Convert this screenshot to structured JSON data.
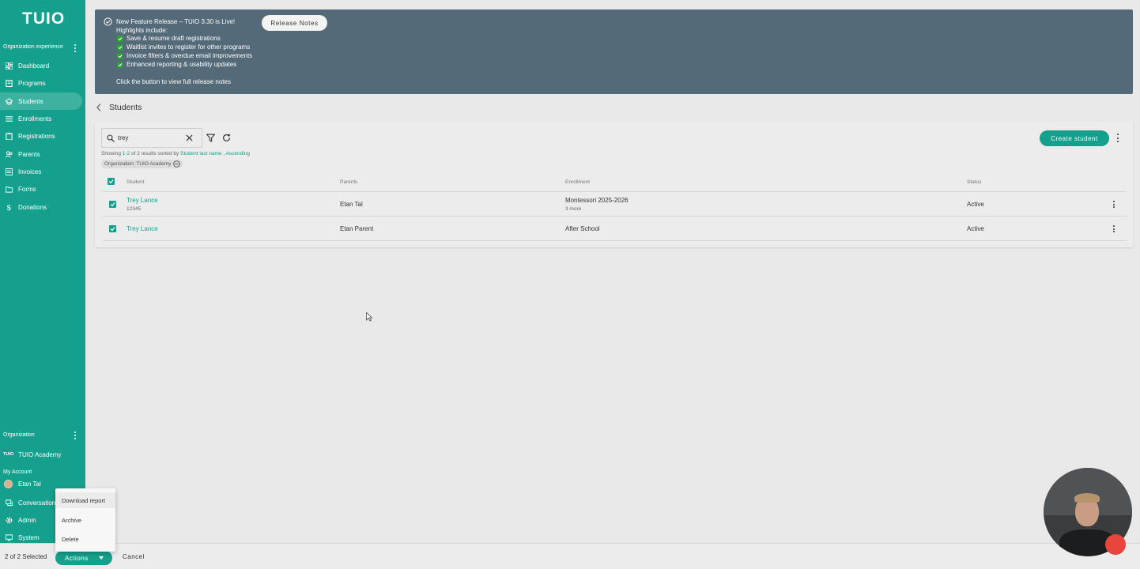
{
  "colors": {
    "brand": "#14a08c",
    "banner": "#546a78",
    "check": "#2f9e3a"
  },
  "sidebar": {
    "logo": "TUIO",
    "section_org_experience": "Organization experience",
    "nav": [
      {
        "label": "Dashboard",
        "icon": "dashboard-icon"
      },
      {
        "label": "Programs",
        "icon": "book-icon"
      },
      {
        "label": "Students",
        "icon": "graduation-cap-icon",
        "active": true
      },
      {
        "label": "Enrollments",
        "icon": "list-icon"
      },
      {
        "label": "Registrations",
        "icon": "clipboard-icon"
      },
      {
        "label": "Parents",
        "icon": "people-icon"
      },
      {
        "label": "Invoices",
        "icon": "receipt-icon"
      },
      {
        "label": "Forms",
        "icon": "folder-icon"
      },
      {
        "label": "Donations",
        "icon": "dollar-icon"
      }
    ],
    "section_organization": "Organization",
    "org_badge": "TUIO",
    "org_name": "TUIO Academy",
    "section_my_account": "My Account",
    "account_name": "Etan Tal",
    "bottom_nav": [
      {
        "label": "Conversations",
        "icon": "chat-icon"
      },
      {
        "label": "Admin",
        "icon": "gear-icon"
      },
      {
        "label": "System",
        "icon": "monitor-icon"
      }
    ]
  },
  "banner": {
    "title": "New Feature Release – TUIO 3.30 is Live!",
    "subtitle": "Highlights include:",
    "highlights": [
      "Save & resume draft registrations",
      "Waitlist invites to register for other programs",
      "Invoice filters & overdue email improvements",
      "Enhanced reporting & usability updates"
    ],
    "footer": "Click the button to view full release notes",
    "button": "Release Notes"
  },
  "page": {
    "title": "Students"
  },
  "toolbar": {
    "search_value": "trey",
    "results_prefix": "Showing ",
    "results_range": "1-2",
    "results_mid": " of 2 results sorted by ",
    "sort_field": "Student last name",
    "sort_sep": " , ",
    "sort_dir": "Ascending",
    "filter_chip": "Organization: TUIO Academy",
    "create_button": "Create student"
  },
  "table": {
    "columns": [
      "Student",
      "Parents",
      "Enrollment",
      "Status"
    ],
    "rows": [
      {
        "student": "Trey Lance",
        "student_id": "12345",
        "parents": "Etan Tal",
        "enrollment": "Montessori 2025-2026",
        "enrollment_more": "3 more",
        "status": "Active",
        "checked": true
      },
      {
        "student": "Trey Lance",
        "student_id": "",
        "parents": "Etan Parent",
        "enrollment": "After School",
        "enrollment_more": "",
        "status": "Active",
        "checked": true
      }
    ]
  },
  "bulk_bar": {
    "selected": "2 of 2 Selected",
    "actions": "Actions",
    "cancel": "Cancel"
  },
  "actions_menu": [
    "Download report",
    "Archive",
    "Delete"
  ]
}
